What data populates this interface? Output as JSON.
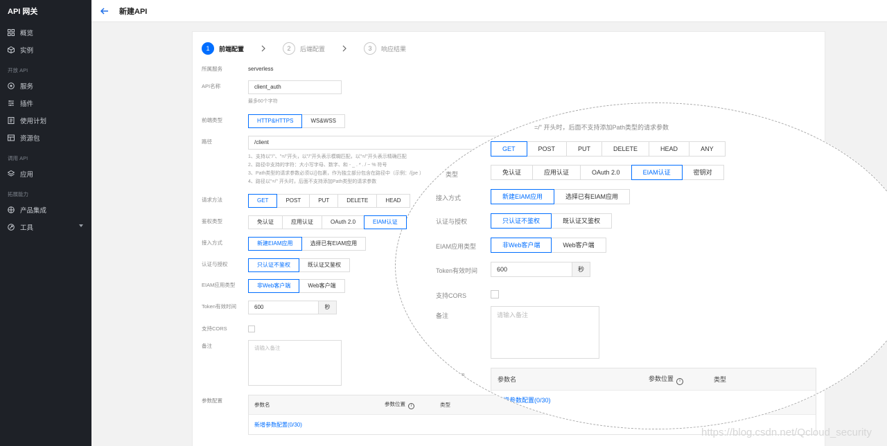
{
  "app": {
    "title": "API 网关"
  },
  "sidebar": {
    "items_top": [
      {
        "label": "概览",
        "icon": "grid-icon"
      },
      {
        "label": "实例",
        "icon": "cube-icon"
      }
    ],
    "group_open_api": "开放 API",
    "items_open_api": [
      {
        "label": "服务",
        "icon": "service-icon"
      },
      {
        "label": "插件",
        "icon": "plugin-icon"
      },
      {
        "label": "使用计划",
        "icon": "plan-icon"
      },
      {
        "label": "资源包",
        "icon": "package-icon"
      }
    ],
    "group_call_api": "调用 API",
    "items_call_api": [
      {
        "label": "应用",
        "icon": "app-icon"
      }
    ],
    "group_ext": "拓展能力",
    "items_ext": [
      {
        "label": "产品集成",
        "icon": "integration-icon"
      },
      {
        "label": "工具",
        "icon": "tool-icon"
      }
    ]
  },
  "header": {
    "title": "新建API"
  },
  "steps": [
    {
      "num": "1",
      "label": "前端配置"
    },
    {
      "num": "2",
      "label": "后端配置"
    },
    {
      "num": "3",
      "label": "响应结果"
    }
  ],
  "form": {
    "service_label": "所属服务",
    "service_value": "serverless",
    "name_label": "API名称",
    "name_value": "client_auth",
    "name_hint": "最多60个字符",
    "frontend_type_label": "前端类型",
    "frontend_types": [
      "HTTP&HTTPS",
      "WS&WSS"
    ],
    "path_label": "路径",
    "path_value": "/client",
    "path_hints": [
      "1、支持以\"/\"、\"=/\"开头，以\"/\"开头表示模糊匹配，以\"=/\"开头表示精确匹配",
      "2、路径中支持的字符：大小写字母、数字、和 - _ . * . / ~ % 符号",
      "3、Path类型的请求参数必须以{}包裹，作为独立部分包含在路径中（示例：/{pe  ）",
      "4、路径以\"=/\" 开头时，后面不支持添加Path类型的请求参数"
    ],
    "method_label": "请求方法",
    "methods": [
      "GET",
      "POST",
      "PUT",
      "DELETE",
      "HEAD"
    ],
    "auth_label": "鉴权类型",
    "auth_types": [
      "免认证",
      "应用认证",
      "OAuth 2.0",
      "EIAM认证"
    ],
    "access_label": "接入方式",
    "access_types": [
      "新建EIAM应用",
      "选择已有EIAM应用"
    ],
    "authz_label": "认证与授权",
    "authz_types": [
      "只认证不鉴权",
      "既认证又鉴权"
    ],
    "app_type_label": "EIAM应用类型",
    "app_types": [
      "非Web客户端",
      "Web客户端"
    ],
    "token_label": "Token有效时间",
    "token_value": "600",
    "token_unit": "秒",
    "cors_label": "支持CORS",
    "remark_label": "备注",
    "remark_placeholder": "请输入备注",
    "params_label": "参数配置",
    "params_cols": [
      "参数名",
      "参数位置",
      "类型"
    ],
    "params_add": "新增参数配置(0/30)"
  },
  "zoom": {
    "top_text": "=/\" 开头时，后面不支持添加Path类型的请求参数",
    "methods": [
      "GET",
      "POST",
      "PUT",
      "DELETE",
      "HEAD",
      "ANY"
    ],
    "auth_types": [
      "免认证",
      "应用认证",
      "OAuth 2.0",
      "EIAM认证",
      "密钥对"
    ],
    "partial_label": "类型",
    "partial_label2": "配置"
  },
  "watermark": "https://blog.csdn.net/Qcloud_security"
}
